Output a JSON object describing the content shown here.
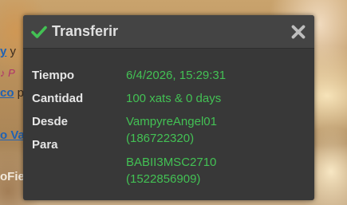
{
  "background": {
    "lines": [
      {
        "link": "y",
        "text": " y"
      },
      {
        "pink": "♪ P"
      },
      {
        "link": "co",
        "text": " p"
      },
      {
        "link": "o Va",
        "text": ""
      },
      {
        "text": "oFie"
      }
    ]
  },
  "dialog": {
    "title": "Transferir",
    "header_icon": "check-icon",
    "close_icon": "close-icon",
    "colors": {
      "accent": "#43c154",
      "background": "#383838",
      "header": "#444444",
      "label": "#e6e6e6"
    },
    "fields": {
      "time_label": "Tiempo",
      "time_value": "6/4/2026, 15:29:31",
      "amount_label": "Cantidad",
      "amount_value": "100 xats & 0 days",
      "from_label": "Desde",
      "from_name": "VampyreAngel01",
      "from_id": "(186722320)",
      "to_label": "Para",
      "to_name": "BABII3MSC2710",
      "to_id": "(1522856909)"
    }
  }
}
